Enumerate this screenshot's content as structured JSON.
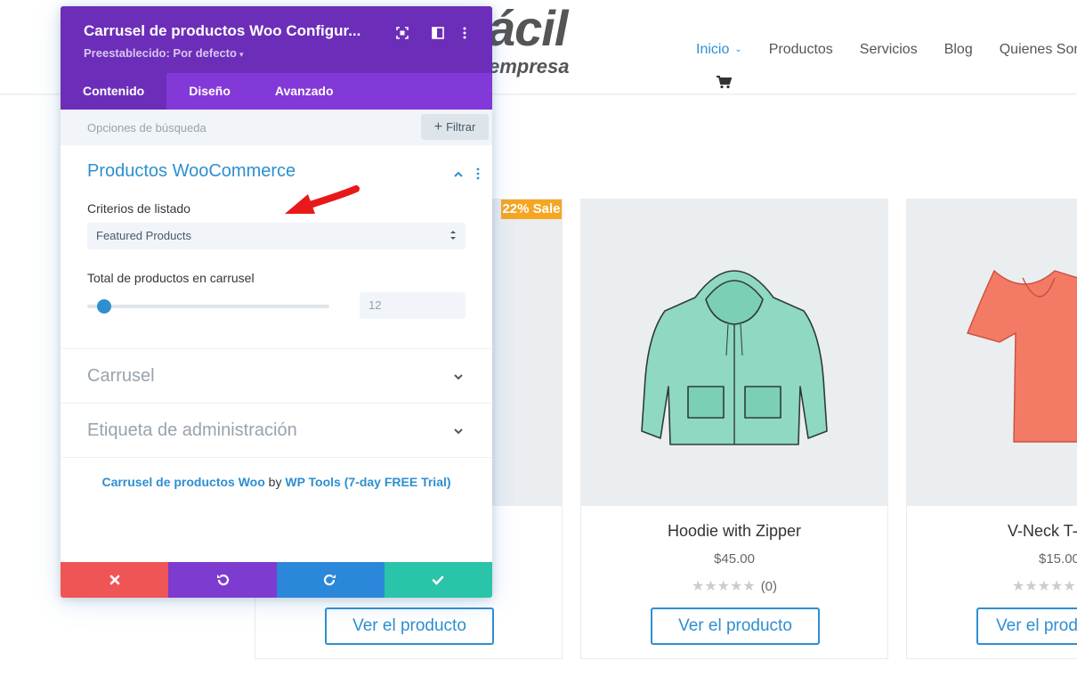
{
  "site": {
    "logo_text": "ácil",
    "logo_sub": "empresa",
    "nav": [
      {
        "label": "Inicio",
        "active": true
      },
      {
        "label": "Productos",
        "active": false
      },
      {
        "label": "Servicios",
        "active": false
      },
      {
        "label": "Blog",
        "active": false
      },
      {
        "label": "Quienes Somos",
        "active": false
      }
    ],
    "cart_icon": "cart-icon",
    "sale_badge": "22% Sale",
    "products": [
      {
        "name": "",
        "price": "",
        "rating_count": "",
        "button": "Ver el producto"
      },
      {
        "name": "Hoodie with Zipper",
        "price": "$45.00",
        "rating_count": "(0)",
        "button": "Ver el producto"
      },
      {
        "name": "V-Neck T-Shirt",
        "price": "$15.00",
        "rating_count": "",
        "button": "Ver el producto"
      }
    ]
  },
  "modal": {
    "title": "Carrusel de productos Woo Configur...",
    "preset": "Preestablecido: Por defecto",
    "tabs": [
      {
        "label": "Contenido",
        "active": true
      },
      {
        "label": "Diseño",
        "active": false
      },
      {
        "label": "Avanzado",
        "active": false
      }
    ],
    "search_placeholder": "Opciones de búsqueda",
    "filter_label": "Filtrar",
    "section_open": {
      "title": "Productos WooCommerce",
      "criteria_label": "Criterios de listado",
      "criteria_value": "Featured Products",
      "total_label": "Total de productos en carrusel",
      "total_value": "12",
      "slider_fraction": 0.07
    },
    "section_carousel": "Carrusel",
    "section_admin": "Etiqueta de administración",
    "footer": {
      "link1": "Carrusel de productos Woo",
      "by": "by",
      "link2": "WP Tools (7-day FREE Trial)"
    },
    "colors": {
      "header": "#6c2eb9",
      "tabs": "#8339d7",
      "cancel": "#ef5555",
      "undo": "#7e3bd0",
      "redo": "#2b87da",
      "save": "#29c4a9",
      "accent": "#2e8fd0"
    }
  }
}
